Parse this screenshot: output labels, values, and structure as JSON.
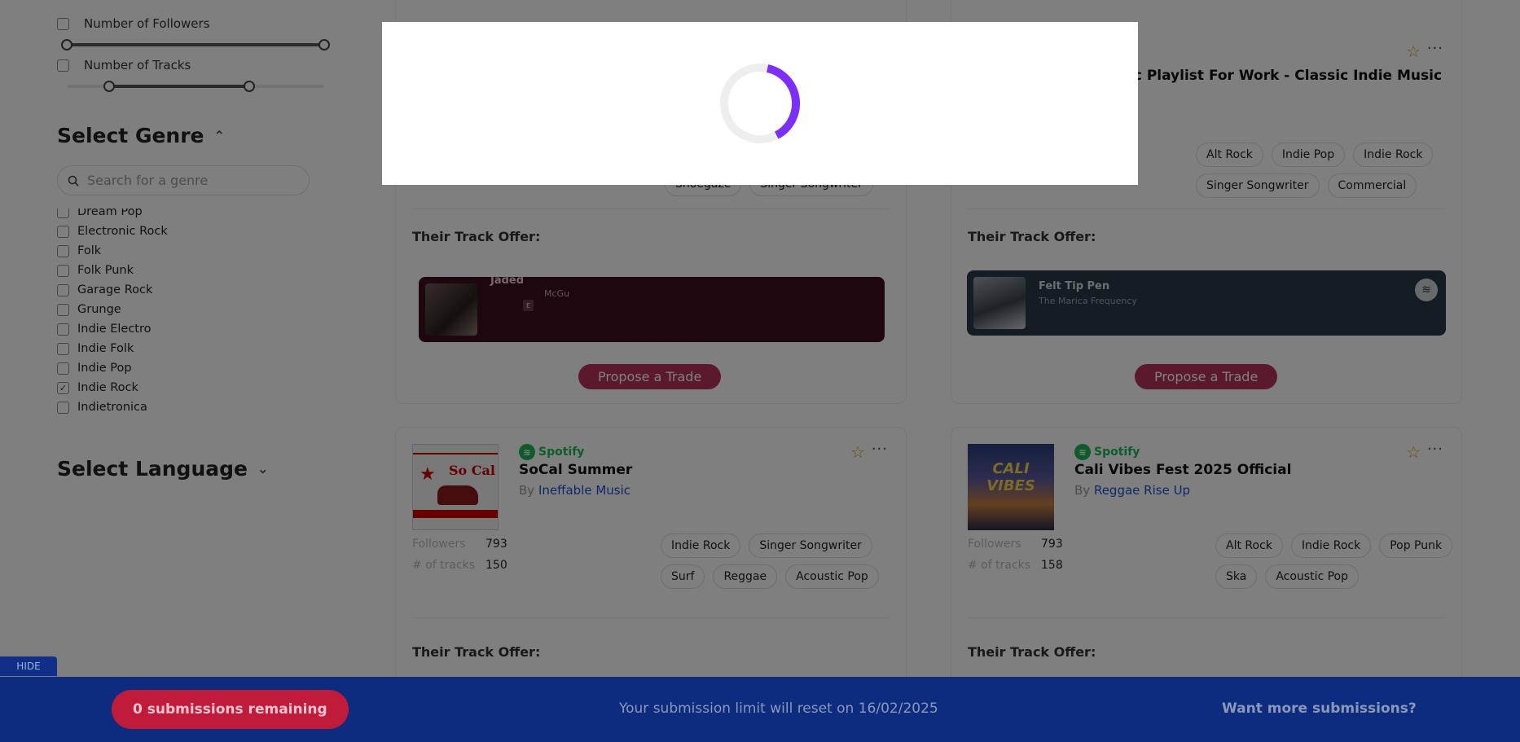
{
  "sidebar": {
    "filters": [
      {
        "label": "Number of Followers",
        "checked": false
      },
      {
        "label": "Number of Tracks",
        "checked": false
      }
    ],
    "genre_title": "Select Genre",
    "genre_search_placeholder": "Search for a genre",
    "genres": [
      {
        "label": "Dream Pop",
        "checked": false
      },
      {
        "label": "Electronic Rock",
        "checked": false
      },
      {
        "label": "Folk",
        "checked": false
      },
      {
        "label": "Folk Punk",
        "checked": false
      },
      {
        "label": "Garage Rock",
        "checked": false
      },
      {
        "label": "Grunge",
        "checked": false
      },
      {
        "label": "Indie Electro",
        "checked": false
      },
      {
        "label": "Indie Folk",
        "checked": false
      },
      {
        "label": "Indie Pop",
        "checked": false
      },
      {
        "label": "Indie Rock",
        "checked": true
      },
      {
        "label": "Indietronica",
        "checked": false
      }
    ],
    "language_title": "Select Language"
  },
  "cards": {
    "c1": {
      "tags_row": [
        "Shoegaze",
        "Singer Songwriter"
      ],
      "offer_label": "Their Track Offer:",
      "track_title": "Jaded",
      "track_artist": "McGu",
      "explicit": "E",
      "propose": "Propose a Trade"
    },
    "c2": {
      "title_partial": "ic Playlist For Work - Classic Indie Music",
      "tags": [
        "Alt Rock",
        "Indie Pop",
        "Indie Rock",
        "Singer Songwriter",
        "Commercial"
      ],
      "offer_label": "Their Track Offer:",
      "track_title": "Felt Tip Pen",
      "track_artist": "The Marica Frequency",
      "propose": "Propose a Trade"
    },
    "c3": {
      "brand": "Spotify",
      "title": "SoCal Summer",
      "by_prefix": "By",
      "curator": "Ineffable Music",
      "followers_label": "Followers",
      "followers": "793",
      "tracks_label": "# of tracks",
      "tracks": "150",
      "tags": [
        "Indie Rock",
        "Singer Songwriter",
        "Surf",
        "Reggae",
        "Acoustic Pop"
      ],
      "offer_label": "Their Track Offer:",
      "art_text": "So Cal"
    },
    "c4": {
      "brand": "Spotify",
      "title": "Cali Vibes Fest 2025 Official",
      "by_prefix": "By",
      "curator": "Reggae Rise Up",
      "followers_label": "Followers",
      "followers": "793",
      "tracks_label": "# of tracks",
      "tracks": "158",
      "tags": [
        "Alt Rock",
        "Indie Rock",
        "Pop Punk",
        "Ska",
        "Acoustic Pop"
      ],
      "offer_label": "Their Track Offer:",
      "art_text": "CALI VIBES"
    }
  },
  "footer": {
    "hide": "HIDE",
    "remaining": "0 submissions remaining",
    "reset": "Your submission limit will reset on 16/02/2025",
    "more": "Want more submissions?"
  },
  "colors": {
    "accent": "#7b2ff7",
    "propose": "#b7325a",
    "footer": "#0d2c7f",
    "remaining": "#c11b3c",
    "spotify": "#1DB954"
  },
  "icons": [
    "search-icon",
    "chevron-up-icon",
    "chevron-down-icon",
    "star-icon",
    "more-icon",
    "spotify-icon",
    "loading-spinner-icon",
    "check-icon"
  ]
}
